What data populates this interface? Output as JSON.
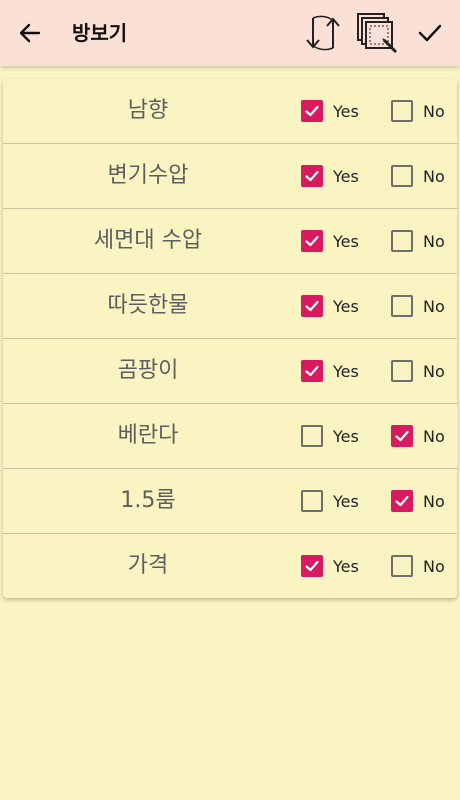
{
  "header": {
    "title": "방보기",
    "back_icon": "arrow-left-icon",
    "actions": [
      {
        "name": "swap-icon"
      },
      {
        "name": "select-area-icon"
      },
      {
        "name": "check-icon"
      }
    ]
  },
  "colors": {
    "header_bg": "#fbe0d5",
    "body_bg": "#faf4c3",
    "accent": "#d81b60"
  },
  "options": {
    "yes_label": "Yes",
    "no_label": "No"
  },
  "rows": [
    {
      "label": "남향",
      "yes": true,
      "no": false
    },
    {
      "label": "변기수압",
      "yes": true,
      "no": false
    },
    {
      "label": "세면대 수압",
      "yes": true,
      "no": false
    },
    {
      "label": "따듯한물",
      "yes": true,
      "no": false
    },
    {
      "label": "곰팡이",
      "yes": true,
      "no": false
    },
    {
      "label": "베란다",
      "yes": false,
      "no": true
    },
    {
      "label": "1.5룸",
      "yes": false,
      "no": true
    },
    {
      "label": "가격",
      "yes": true,
      "no": false
    }
  ]
}
